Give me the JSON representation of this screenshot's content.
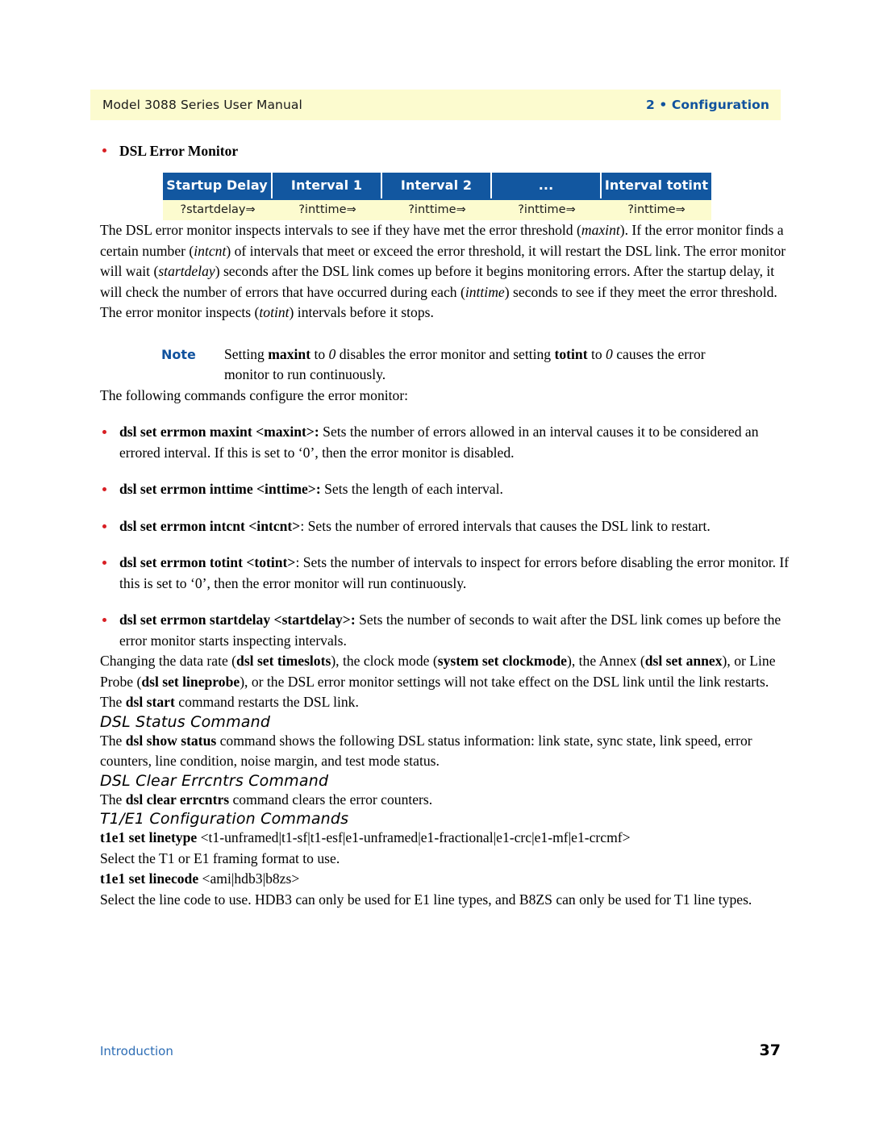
{
  "header": {
    "left": "Model 3088 Series User Manual",
    "right": "2 • Configuration"
  },
  "section_heading": "DSL Error Monitor",
  "interval_table": {
    "columns": [
      "Startup Delay",
      "Interval 1",
      "Interval 2",
      "...",
      "Interval totint"
    ],
    "values": [
      "?startdelay⇒",
      "?inttime⇒",
      "?inttime⇒",
      "?inttime⇒",
      "?inttime⇒"
    ],
    "header_bg": "#1257a0",
    "row_bg": "#fcfbcf"
  },
  "intro_paragraph": {
    "p1": "The DSL error monitor inspects intervals to see if they have met the error threshold (",
    "i1": "maxint",
    "p2": "). If the error monitor finds a certain number (",
    "i2": "intcnt",
    "p3": ") of intervals that meet or exceed the error threshold, it will restart the DSL link. The error monitor will wait (",
    "i3": "startdelay",
    "p4": ") seconds after the DSL link comes up before it begins monitoring errors. After the startup delay, it will check the number of errors that have occurred during each (",
    "i4": "inttime",
    "p5": ") seconds to see if they meet the error threshold. The error monitor inspects (",
    "i5": "totint",
    "p6": ") intervals before it stops."
  },
  "note": {
    "label": "Note",
    "t1": "Setting ",
    "b1": "maxint",
    "t2": " to ",
    "i1": "0",
    "t3": " disables the error monitor and setting ",
    "b2": "totint",
    "t4": " to ",
    "i2": "0",
    "t5": " causes the error monitor to run continuously."
  },
  "commands_intro": "The following commands configure the error monitor:",
  "commands": [
    {
      "name": "dsl set errmon maxint <maxint>:",
      "desc": " Sets the number of errors allowed in an interval causes it to be considered an errored interval. If this is set to ‘0’, then the error monitor is disabled."
    },
    {
      "name": "dsl set errmon inttime <inttime>:",
      "desc": " Sets the length of each interval."
    },
    {
      "name": "dsl set errmon intcnt <intcnt>",
      "desc": ": Sets the number of errored intervals that causes the DSL link to restart."
    },
    {
      "name": "dsl set errmon totint <totint>",
      "desc": ": Sets the number of intervals to inspect for errors before disabling the error monitor. If this is set to ‘0’, then the error monitor will run continuously."
    },
    {
      "name": "dsl set errmon startdelay <startdelay>:",
      "desc": " Sets the number of seconds to wait after the DSL link comes up before the error monitor starts inspecting intervals."
    }
  ],
  "changing_paragraph": {
    "t1": "Changing the data rate (",
    "b1": "dsl set timeslots",
    "t2": "), the clock mode (",
    "b2": "system set clockmode",
    "t3": "), the Annex (",
    "b3": "dsl set annex",
    "t4": "), or Line Probe (",
    "b4": "dsl set lineprobe",
    "t5": "), or the DSL error monitor settings will not take effect on the DSL link until the link restarts. The ",
    "b5": "dsl start",
    "t6": " command restarts the DSL link."
  },
  "status_section": {
    "heading": "DSL Status Command",
    "t1": "The ",
    "b1": "dsl show status",
    "t2": " command shows the following DSL status information: link state, sync state, link speed, error counters, line condition, noise margin, and test mode status."
  },
  "clear_section": {
    "heading": "DSL Clear Errcntrs Command",
    "t1": "The ",
    "b1": "dsl clear errcntrs",
    "t2": " command clears the error counters."
  },
  "t1e1_section": {
    "heading": "T1/E1 Configuration Commands",
    "linetype_cmd": "t1e1 set linetype",
    "linetype_args": " <t1-unframed|t1-sf|t1-esf|e1-unframed|e1-fractional|e1-crc|e1-mf|e1-crcmf>",
    "linetype_desc": "Select the T1 or E1 framing format to use.",
    "linecode_cmd": "t1e1 set linecode",
    "linecode_args": " <ami|hdb3|b8zs>",
    "linecode_desc": "Select the line code to use. HDB3 can only be used for E1 line types, and B8ZS can only be used for T1 line types."
  },
  "footer": {
    "left": "Introduction",
    "right": "37"
  }
}
